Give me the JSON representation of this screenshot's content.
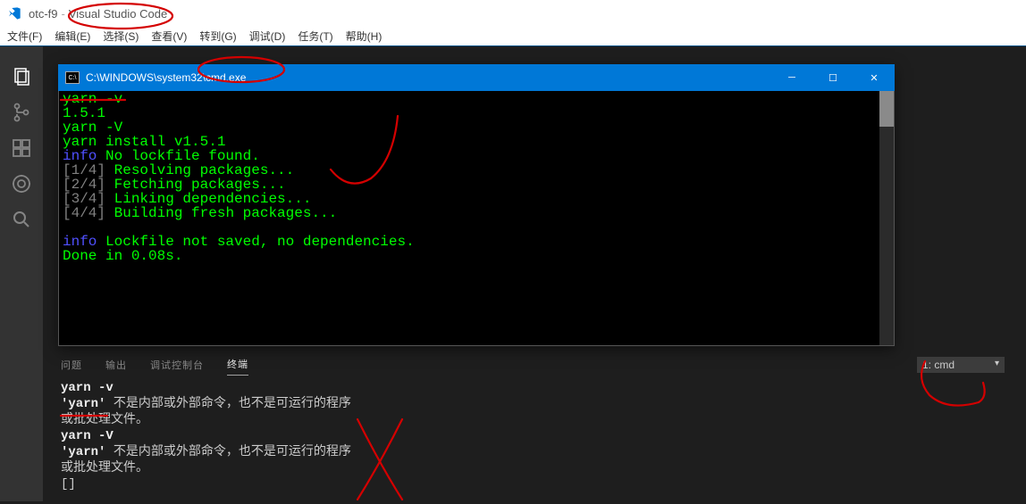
{
  "title_bar": {
    "project": "otc-f9",
    "app": "Visual Studio Code"
  },
  "menu": {
    "file": "文件(F)",
    "edit": "编辑(E)",
    "select": "选择(S)",
    "view": "查看(V)",
    "goto": "转到(G)",
    "debug": "调试(D)",
    "tasks": "任务(T)",
    "help": "帮助(H)"
  },
  "cmd": {
    "title": "C:\\WINDOWS\\system32\\cmd.exe",
    "lines": {
      "l1": "yarn -v",
      "l2": "1.5.1",
      "l3": "yarn -V",
      "l4": "yarn install v1.5.1",
      "l5_info": "info",
      "l5_rest": " No lockfile found.",
      "l6_tag": "[1/4]",
      "l6_rest": " Resolving packages...",
      "l7_tag": "[2/4]",
      "l7_rest": " Fetching packages...",
      "l8_tag": "[3/4]",
      "l8_rest": " Linking dependencies...",
      "l9_tag": "[4/4]",
      "l9_rest": " Building fresh packages...",
      "l10_info": "info",
      "l10_rest": " Lockfile not saved, no dependencies.",
      "l11": "Done in 0.08s."
    }
  },
  "panel": {
    "tabs": {
      "problems": "问题",
      "output": "输出",
      "debug_console": "调试控制台",
      "terminal": "终端"
    },
    "dropdown": "1: cmd",
    "body": {
      "l1": "yarn -v",
      "l2a": "'yarn'",
      "l2b": " 不是内部或外部命令，也不是可运行的程序",
      "l3": "或批处理文件。",
      "l4": "yarn -V",
      "l5a": "'yarn'",
      "l5b": " 不是内部或外部命令，也不是可运行的程序",
      "l6": "或批处理文件。",
      "l7": "[]"
    }
  }
}
